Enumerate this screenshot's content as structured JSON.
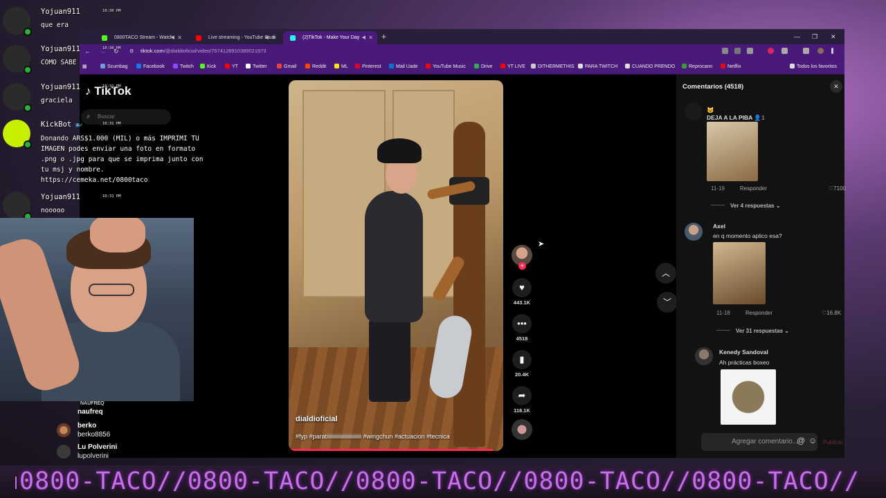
{
  "browser": {
    "tabs": [
      {
        "label": "0800TACO Stream - Watch",
        "color": "#53fc18"
      },
      {
        "label": "Live streaming - YouTube Studi",
        "color": "#ff0000"
      },
      {
        "label": "(2)TikTok - Make Your Day",
        "color": "#25f4ee"
      }
    ],
    "url_host": "tiktok.com",
    "url_path": "/@dialdioficial/video/7574128910389021973",
    "bookmarks": [
      "Scumbag",
      "Facebook",
      "Twitch",
      "Kick",
      "YT",
      "Twitter",
      "Gmail",
      "Reddit",
      "ML",
      "Pinterest",
      "Mail Uade",
      "YouTube Music",
      "Drive",
      "YT LIVE",
      "DITHERMETHIS",
      "PARA TWITCH",
      "CUANDO PRENDO",
      "Reprocann",
      "Netflix"
    ],
    "all_bookmarks": "Todos los favoritos"
  },
  "tiktok": {
    "logo": "TikTok",
    "search_placeholder": "Buscar",
    "author": "dialdioficial",
    "caption": "#fyp #paratiiiiiiiiiiiiiiiiiiiiiiiii #wingchun #actuacion #tecnica",
    "progress": 0.95,
    "likes": "443.1K",
    "comments": "4518",
    "saves": "20.4K",
    "shares": "118.1K"
  },
  "comments_panel": {
    "title": "Comentarios (4518)",
    "items": [
      {
        "name": "DEJA A LA PIBA",
        "meta_date": "11-19",
        "reply": "Responder",
        "likes": "7100",
        "more": "Ver 4 respuestas"
      },
      {
        "name": "Axel",
        "text": "en q momento aplico esa?",
        "meta_date": "11-18",
        "reply": "Responder",
        "likes": "16.8K",
        "more": "Ver 31 respuestas"
      },
      {
        "name": "Kenedy Sandoval",
        "text": "Ah prácticas boxeo"
      }
    ],
    "friend_count": "1",
    "input_placeholder": "Agregar comentario...",
    "post_label": "Publicar"
  },
  "chat": [
    {
      "user": "Yojuan911",
      "time": "10:30 PM",
      "text": "que era"
    },
    {
      "user": "Yojuan911",
      "time": "10:30 PM",
      "text": "COMO SABE"
    },
    {
      "user": "Yojuan911",
      "time": "10:31 PM",
      "text": "graciela"
    },
    {
      "user": "KickBot",
      "time": "10:31 PM",
      "text": "Donando ARS$1.000 (MIL) o más IMPRIMI TU IMAGEN podes enviar una foto en formato .png o .jpg para que se imprima junto con tu msj y nombre. https://cemeka.net/0800taco"
    },
    {
      "user": "Yojuan911",
      "time": "10:31 PM",
      "text": "nooooo"
    }
  ],
  "viewers": [
    {
      "name": "naufreq",
      "handle": "NAUFREQ"
    },
    {
      "name": "berko",
      "handle": "berko8856"
    },
    {
      "name": "Lu Polverini",
      "handle": "lupolverini"
    }
  ],
  "ticker": "0800-TACO//0800-TACO//0800-TACO//0800-TACO//0800-TACO//",
  "colors": {
    "accent": "#4a1a7a",
    "tiktok_red": "#fe2c55",
    "kick_green": "#2fae3a",
    "ticker": "#c76ee8"
  }
}
